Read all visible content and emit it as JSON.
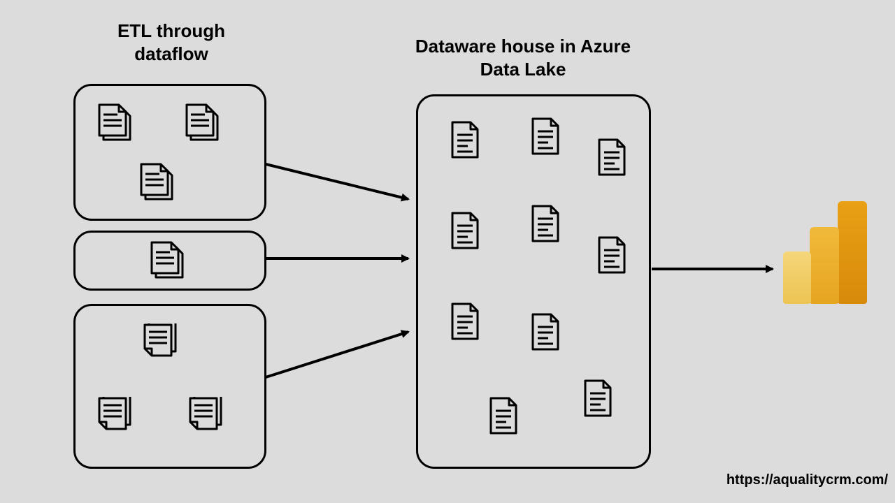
{
  "titles": {
    "etl": "ETL through dataflow",
    "dw": "Dataware house in Azure Data Lake"
  },
  "footer": {
    "url": "https://aqualitycrm.com/"
  },
  "icons": {
    "documents": "documents-icon",
    "file": "file-icon",
    "powerbi": "powerbi-logo"
  }
}
